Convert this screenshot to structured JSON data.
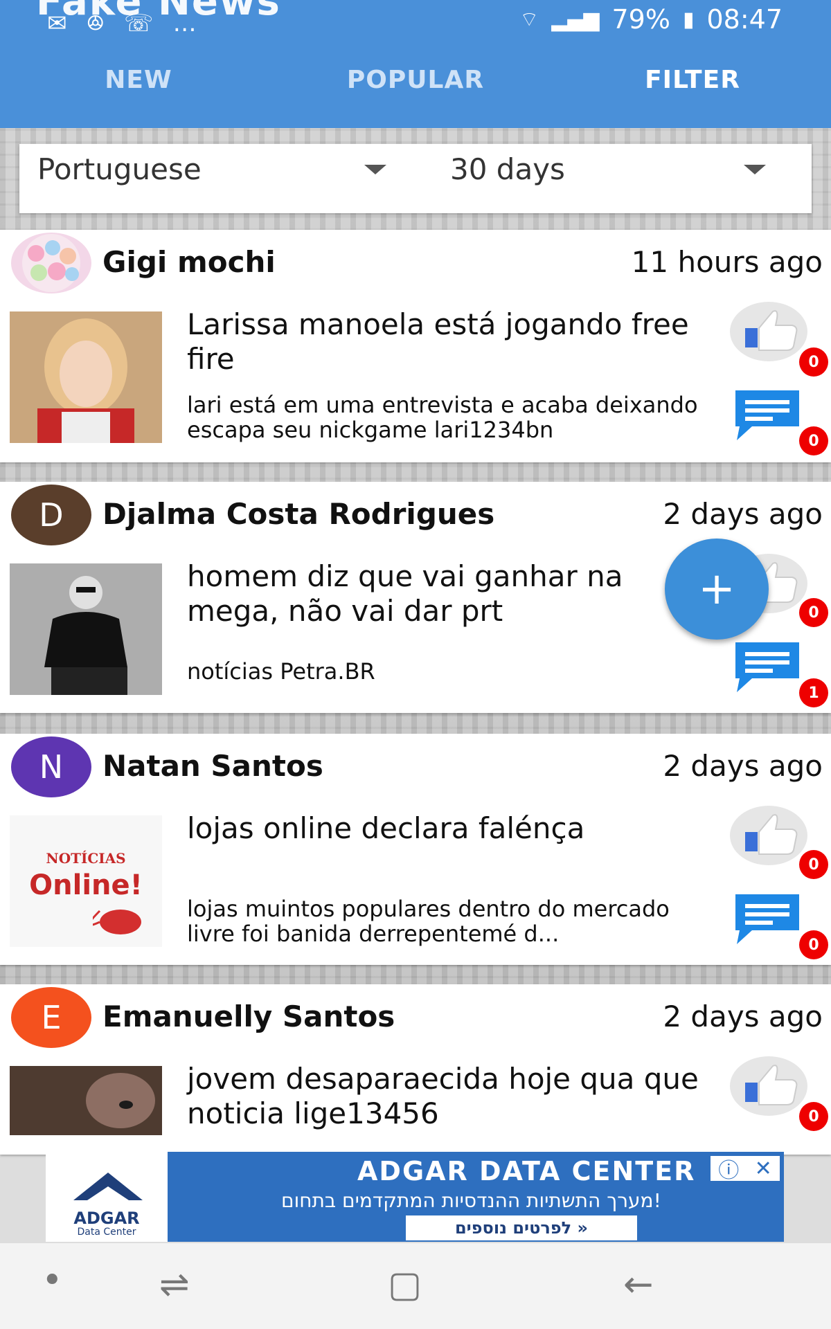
{
  "status": {
    "battery": "79%",
    "time": "08:47",
    "icons": [
      "mail-icon",
      "spiral-icon",
      "phone-icon",
      "more-icon"
    ]
  },
  "app": {
    "name": "Fake News"
  },
  "tabs": [
    {
      "label": "NEW"
    },
    {
      "label": "POPULAR"
    },
    {
      "label": "FILTER"
    }
  ],
  "filters": {
    "language": "Portuguese",
    "period": "30 days"
  },
  "posts": [
    {
      "author": "Gigi mochi",
      "avatar_letter": "",
      "avatar_color": "#f3d7e8",
      "time": "11 hours ago",
      "title": "Larissa manoela está jogando free fire",
      "desc": "lari está em uma entrevista e acaba deixando escapa seu nickgame lari1234bn",
      "likes": "0",
      "comments": "0"
    },
    {
      "author": "Djalma Costa Rodrigues",
      "avatar_letter": "D",
      "avatar_color": "#5a3e2b",
      "time": "2 days ago",
      "title": "homem diz que vai ganhar na mega, não vai dar prt",
      "desc": "notícias Petra.BR",
      "likes": "0",
      "comments": "1"
    },
    {
      "author": "Natan Santos",
      "avatar_letter": "N",
      "avatar_color": "#5e35b1",
      "time": "2 days ago",
      "title": "lojas online declara falénça",
      "desc": "lojas muintos populares dentro do mercado livre foi banida derrepentemé d...",
      "thumb_text1": "NOTÍCIAS",
      "thumb_text2": "Online!",
      "likes": "0",
      "comments": "0"
    },
    {
      "author": "Emanuelly Santos",
      "avatar_letter": "E",
      "avatar_color": "#f4511e",
      "time": "2 days ago",
      "title": "jovem desaparaecida hoje qua que noticia lige13456",
      "desc": "",
      "likes": "0",
      "comments": ""
    }
  ],
  "fab": {
    "label": "+"
  },
  "ad": {
    "brand": "ADGAR",
    "brand_sub": "Data Center",
    "headline": "ADGAR DATA CENTER",
    "subline": "מערך התשתיות ההנדסיות המתקדמים בתחום!",
    "cta": "לפרטים נוספים »",
    "info_icon": "info-icon",
    "close_icon": "close-icon"
  }
}
